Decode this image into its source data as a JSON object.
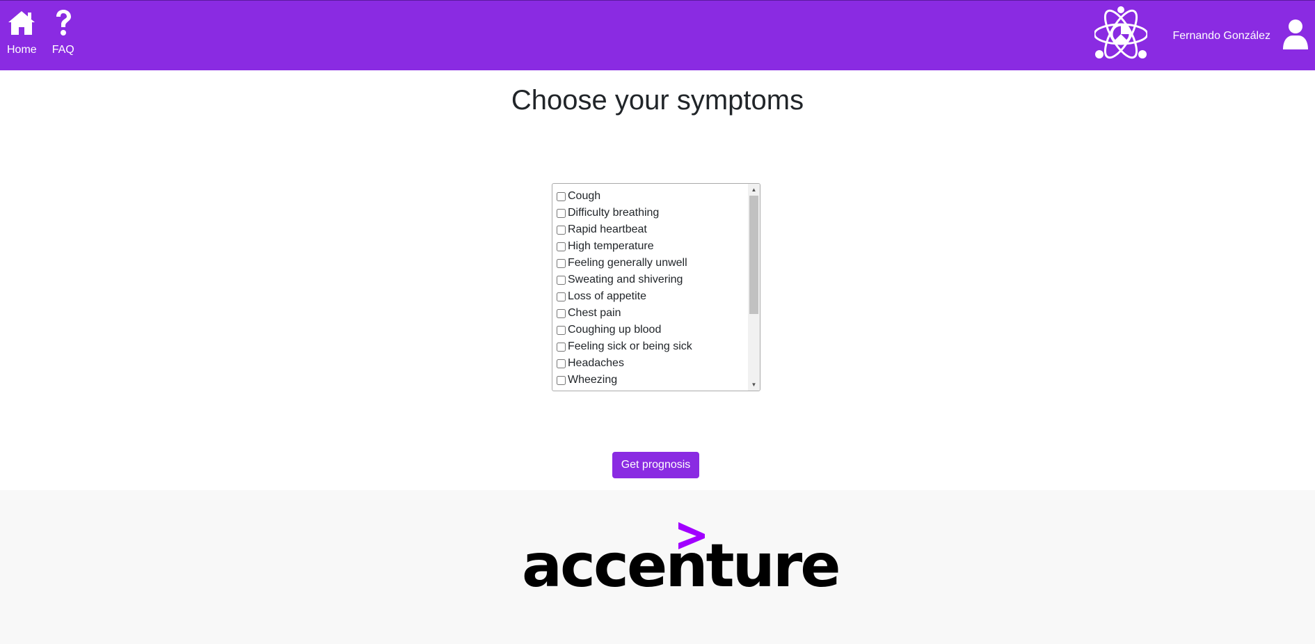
{
  "nav": {
    "home_label": "Home",
    "home_icon": "home-icon",
    "faq_label": "FAQ",
    "faq_icon": "question-mark-icon",
    "app_logo_icon": "atom-chart-logo-icon",
    "username": "Fernando González",
    "user_icon": "user-icon",
    "bg_color": "#8a2be2"
  },
  "main": {
    "title": "Choose your symptoms",
    "symptoms": [
      "Cough",
      "Difficulty breathing",
      "Rapid heartbeat",
      "High temperature",
      "Feeling generally unwell",
      "Sweating and shivering",
      "Loss of appetite",
      "Chest pain",
      "Coughing up blood",
      "Feeling sick or being sick",
      "Headaches",
      "Wheezing"
    ],
    "submit_label": "Get prognosis",
    "accent_color": "#8a2be2"
  },
  "footer": {
    "brand": "accenture",
    "brand_accent": "#a100ff"
  }
}
